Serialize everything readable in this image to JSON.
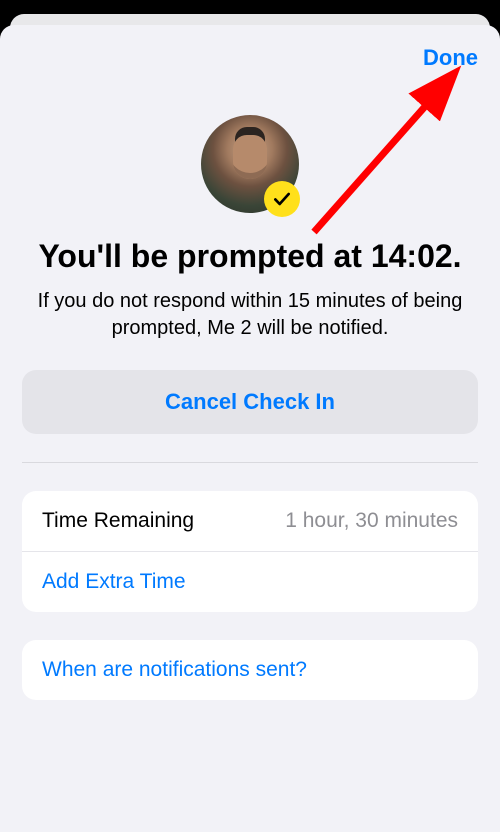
{
  "topbar": {
    "done_label": "Done"
  },
  "avatar": {
    "badge_icon": "check"
  },
  "header": {
    "title": "You'll be prompted at 14:02.",
    "subtitle": "If you do not respond within 15 minutes of being prompted, Me 2 will be notified."
  },
  "actions": {
    "cancel_label": "Cancel Check In"
  },
  "time_card": {
    "remaining_label": "Time Remaining",
    "remaining_value": "1 hour, 30 minutes",
    "add_extra_label": "Add Extra Time"
  },
  "info_card": {
    "notifications_label": "When are notifications sent?"
  },
  "annotation": {
    "arrow_color": "#ff0000"
  }
}
